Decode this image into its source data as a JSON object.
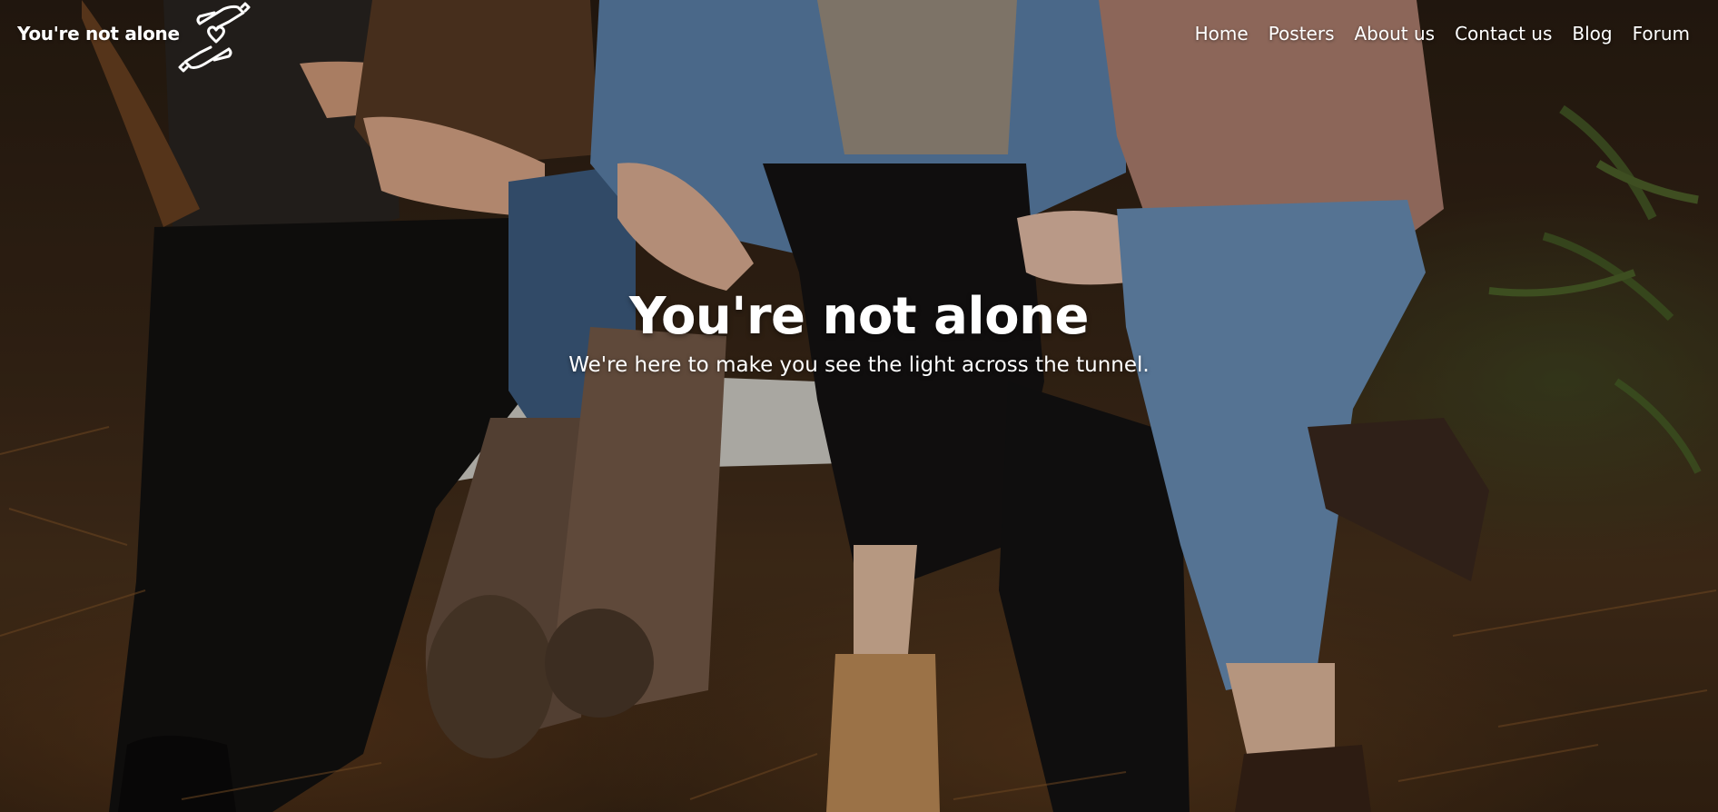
{
  "nav": {
    "brand": "You're not alone",
    "logo_icon": "hands-heart-icon",
    "items": [
      {
        "label": "Home"
      },
      {
        "label": "Posters"
      },
      {
        "label": "About us"
      },
      {
        "label": "Contact us"
      },
      {
        "label": "Blog"
      },
      {
        "label": "Forum"
      }
    ]
  },
  "hero": {
    "title": "You're not alone",
    "subtitle": "We're here to make you see the light across the tunnel.",
    "background_image": "four friends sitting together on the ground, arms linked"
  },
  "colors": {
    "text": "#ffffff",
    "overlay": "#1c140c"
  }
}
